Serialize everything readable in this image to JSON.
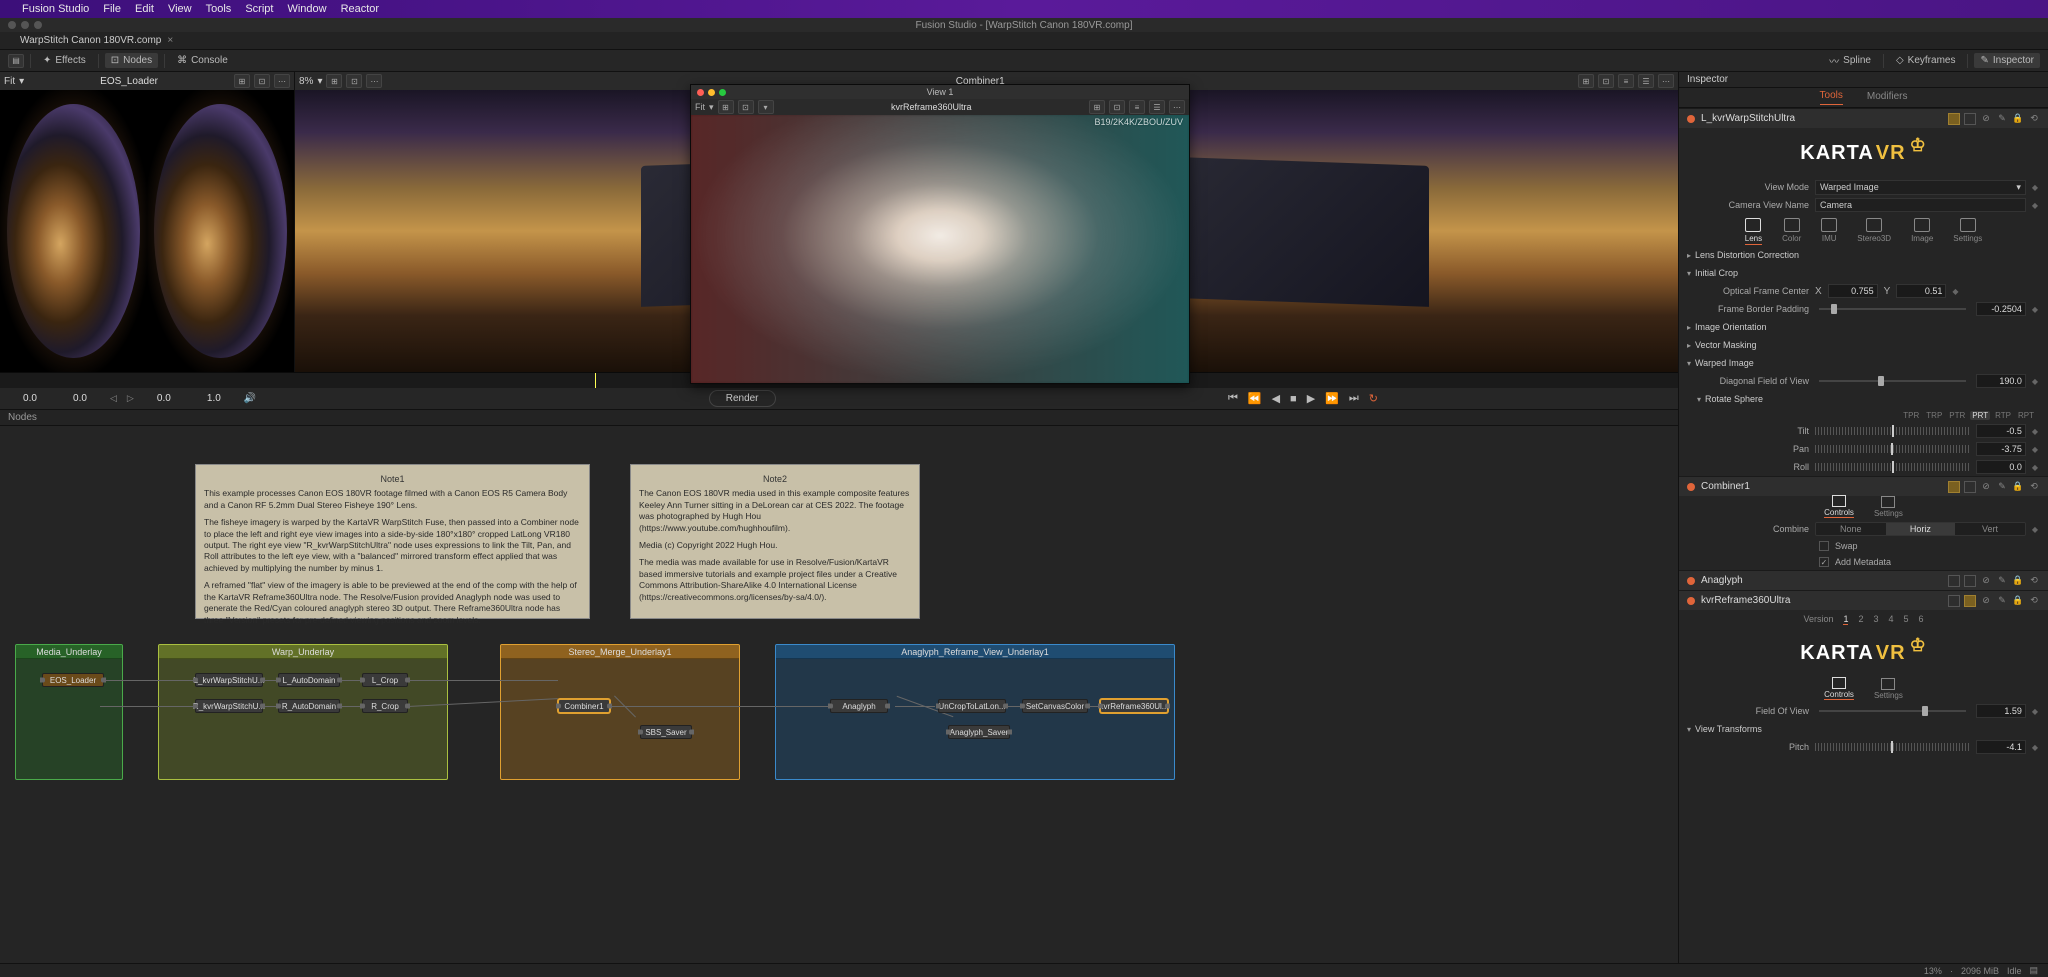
{
  "app": {
    "name": "Fusion Studio",
    "menus": [
      "File",
      "Edit",
      "View",
      "Tools",
      "Script",
      "Window",
      "Reactor"
    ],
    "window_title": "Fusion Studio - [WarpStitch Canon 180VR.comp]",
    "tab": "WarpStitch Canon 180VR.comp"
  },
  "toolbar": {
    "effects": "Effects",
    "nodes": "Nodes",
    "console": "Console",
    "spline": "Spline",
    "keyframes": "Keyframes",
    "inspector": "Inspector"
  },
  "viewer1": {
    "fit": "Fit",
    "title": "EOS_Loader",
    "zoom": "8%"
  },
  "viewer2": {
    "title": "Combiner1"
  },
  "float": {
    "win_title": "View 1",
    "fit": "Fit",
    "title": "kvrReframe360Ultra",
    "coords": "B19/2K4K/ZBOU/ZUV"
  },
  "timeline": {
    "start": "0.0",
    "in": "0.0",
    "cur": "0.0",
    "out": "1.0",
    "render": "Render"
  },
  "nodes_panel": {
    "label": "Nodes"
  },
  "notes": {
    "note1": {
      "title": "Note1",
      "p1": "This example processes Canon EOS 180VR footage filmed with a Canon EOS R5 Camera Body and a Canon RF 5.2mm Dual Stereo Fisheye 190° Lens.",
      "p2": "The fisheye imagery is warped by the KartaVR WarpStitch Fuse, then passed into a Combiner node to place the left and right eye view images into a side-by-side 180°x180° cropped LatLong VR180 output. The right eye view \"R_kvrWarpStitchUltra\" node uses expressions to link the Tilt, Pan, and Roll attributes to the left eye view, with a \"balanced\" mirrored transform effect applied that was achieved by multiplying the number by minus 1.",
      "p3": "A reframed \"flat\" view of the imagery is able to be previewed at the end of the comp with the help of the KartaVR Reframe360Ultra node. The Resolve/Fusion provided Anaglyph node was used to generate the Red/Cyan coloured anaglyph stereo 3D output. There Reframe360Ultra node has three \"Version\" presets for pre-defined viewing positions and zoom levels."
    },
    "note2": {
      "title": "Note2",
      "p1": "The Canon EOS 180VR media used in this example composite features Keeley Ann Turner sitting in a DeLorean car at CES 2022. The footage was photographed by Hugh Hou (https://www.youtube.com/hughhoufilm).",
      "p2": "Media (c) Copyright 2022 Hugh Hou.",
      "p3": "The media was made available for use in Resolve/Fusion/KartaVR based immersive tutorials and example project files under a Creative Commons Attribution-ShareAlike 4.0 International License (https://creativecommons.org/licenses/by-sa/4.0/)."
    }
  },
  "underlays": {
    "media": "Media_Underlay",
    "warp": "Warp_Underlay",
    "stereo": "Stereo_Merge_Underlay1",
    "anaglyph": "Anaglyph_Reframe_View_Underlay1"
  },
  "flow_nodes": {
    "eos": "EOS_Loader",
    "l_warp": "L_kvrWarpStitchU...",
    "r_warp": "R_kvrWarpStitchU...",
    "l_auto": "L_AutoDomain",
    "r_auto": "R_AutoDomain",
    "l_crop": "L_Crop",
    "r_crop": "R_Crop",
    "combiner": "Combiner1",
    "sbs": "SBS_Saver",
    "anaglyph": "Anaglyph",
    "uncrop": "UnCropToLatLon...",
    "canvas": "SetCanvasColor",
    "reframe": "kvrReframe360Ul...",
    "ana_saver": "Anaglyph_Saver"
  },
  "inspector": {
    "tabs": {
      "tools": "Tools",
      "modifiers": "Modifiers"
    },
    "warp": {
      "name": "L_kvrWarpStitchUltra",
      "logo": "KARTA",
      "logo_vr": "VR",
      "view_mode_lbl": "View Mode",
      "view_mode": "Warped Image",
      "cam_name_lbl": "Camera View Name",
      "cam_name": "Camera",
      "modes": [
        "Lens",
        "Color",
        "IMU",
        "Stereo3D",
        "Image",
        "Settings"
      ],
      "lens_dist": "Lens Distortion Correction",
      "initial_crop": "Initial Crop",
      "ofc": "Optical Frame Center",
      "ofc_x_lbl": "X",
      "ofc_x": "0.755",
      "ofc_y_lbl": "Y",
      "ofc_y": "0.51",
      "fbp": "Frame Border Padding",
      "fbp_val": "-0.2504",
      "img_orient": "Image Orientation",
      "vec_mask": "Vector Masking",
      "warped_img": "Warped Image",
      "dfov": "Diagonal Field of View",
      "dfov_val": "190.0",
      "rot_sphere": "Rotate Sphere",
      "rot_order": [
        "TPR",
        "TRP",
        "PTR",
        "PRT",
        "RTP",
        "RPT"
      ],
      "tilt": "Tilt",
      "tilt_val": "-0.5",
      "pan": "Pan",
      "pan_val": "-3.75",
      "roll": "Roll",
      "roll_val": "0.0"
    },
    "combiner": {
      "name": "Combiner1",
      "tabs": [
        "Controls",
        "Settings"
      ],
      "combine": "Combine",
      "opts": [
        "None",
        "Horiz",
        "Vert"
      ],
      "swap": "Swap",
      "meta": "Add Metadata"
    },
    "anaglyph": {
      "name": "Anaglyph"
    },
    "reframe": {
      "name": "kvrReframe360Ultra",
      "version_lbl": "Version",
      "versions": [
        "1",
        "2",
        "3",
        "4",
        "5",
        "6"
      ],
      "tabs": [
        "Controls",
        "Settings"
      ],
      "fov": "Field Of View",
      "fov_val": "1.59",
      "vt": "View Transforms",
      "pitch": "Pitch",
      "pitch_val": "-4.1"
    }
  },
  "status": {
    "pct": "13%",
    "mem": "2096 MiB",
    "state": "Idle"
  }
}
